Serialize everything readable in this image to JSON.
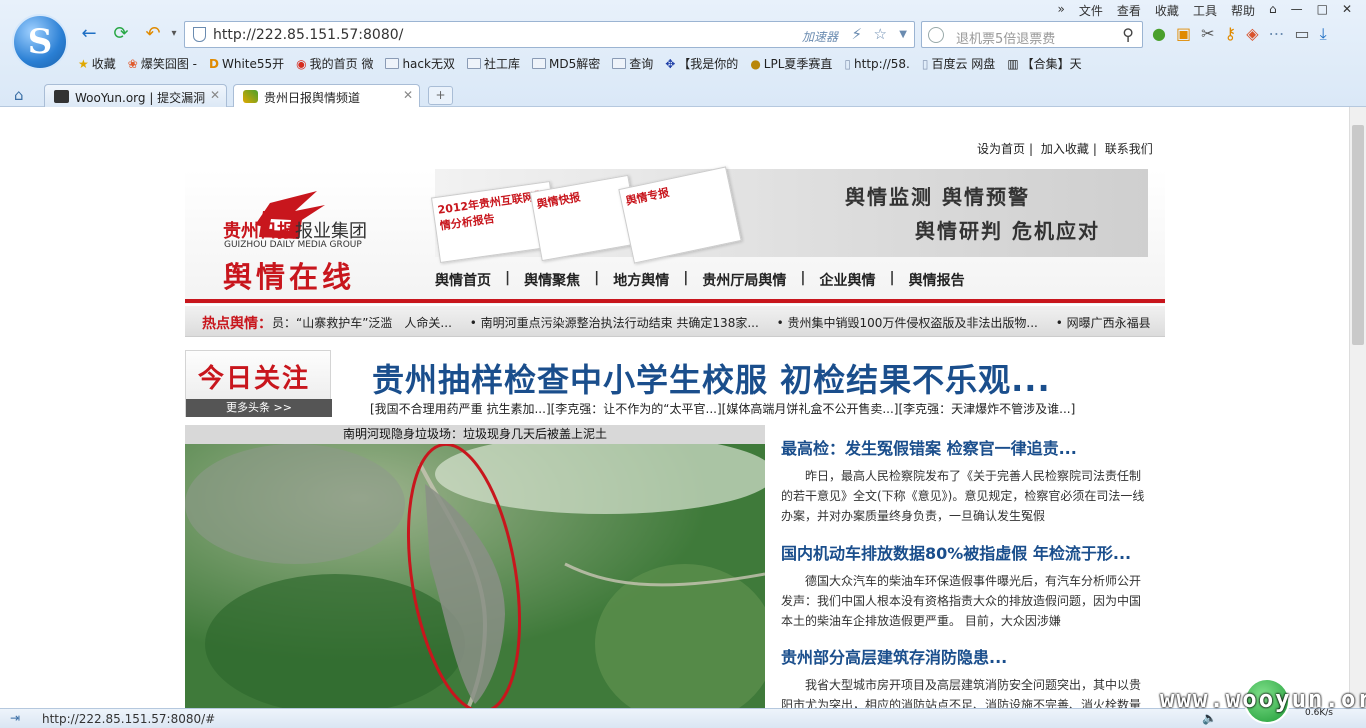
{
  "browser": {
    "menu": [
      "文件",
      "查看",
      "收藏",
      "工具",
      "帮助"
    ],
    "url": "http://222.85.151.57:8080/",
    "accelerator_label": "加速器",
    "search_placeholder": "退机票5倍退票费",
    "bookmarks": [
      "收藏",
      "爆笑囧图 -",
      "White55开",
      "我的首页 微",
      "hack无双",
      "社工库",
      "MD5解密",
      "查询",
      "【我是你的",
      "LPL夏季赛直",
      "http://58.",
      "百度云 网盘",
      "【合集】天"
    ],
    "tabs": [
      {
        "label": "WooYun.org | 提交漏洞",
        "active": false
      },
      {
        "label": "贵州日报舆情频道",
        "active": true
      }
    ],
    "status_url": "http://222.85.151.57:8080/#",
    "speed": "0.6K/s"
  },
  "site": {
    "top_links": [
      "设为首页",
      "加入收藏",
      "联系我们"
    ],
    "brand_name_red": "贵州日报",
    "brand_name_rest": "报业集团",
    "brand_english": "GUIZHOU DAILY MEDIA GROUP",
    "brand_main": "舆情在线",
    "banner_papers": [
      "2012年贵州互联网舆情分析报告",
      "舆情快报",
      "舆情专报"
    ],
    "slogan_line1": "舆情监测  舆情预警",
    "slogan_line2": "舆情研判  危机应对",
    "nav": [
      "舆情首页",
      "舆情聚焦",
      "地方舆情",
      "贵州厅局舆情",
      "企业舆情",
      "舆情报告"
    ],
    "hot_label": "热点舆情：",
    "hot_items": [
      "员：“山寨救护车”泛滥　人命关...",
      "• 南明河重点污染源整治执法行动结束 共确定138家...",
      "• 贵州集中销毁100万件侵权盗版及非法出版物...",
      "• 网曝广西永福县"
    ],
    "focus_title": "今日关注",
    "focus_more": "更多头条 >>",
    "headline": "贵州抽样检查中小学生校服 初检结果不乐观...",
    "subheads": "[我国不合理用药严重 抗生素加...][李克强：让不作为的“太平官...][媒体高端月饼礼盒不公开售卖...][李克强：天津爆炸不管涉及谁...]",
    "image_caption": "南明河现隐身垃圾场：垃圾现身几天后被盖上泥土",
    "news": [
      {
        "title": "最高检：发生冤假错案 检察官一律追责...",
        "body": "昨日，最高人民检察院发布了《关于完善人民检察院司法责任制的若干意见》全文(下称《意见》)。意见规定，检察官必须在司法一线办案，并对办案质量终身负责，一旦确认发生冤假"
      },
      {
        "title": "国内机动车排放数据80%被指虚假 年检流于形...",
        "body": "德国大众汽车的柴油车环保造假事件曝光后，有汽车分析师公开发声：我们中国人根本没有资格指责大众的排放造假问题，因为中国本土的柴油车企排放造假更严重。 目前，大众因涉嫌"
      },
      {
        "title": "贵州部分高层建筑存消防隐患...",
        "body": "我省大型城市房开项目及高层建筑消防安全问题突出，其中以贵阳市尤为突出，相应的消防站点不足、消防设施不完善、消火栓数量"
      }
    ],
    "watermark": "www.wooyun.org"
  }
}
